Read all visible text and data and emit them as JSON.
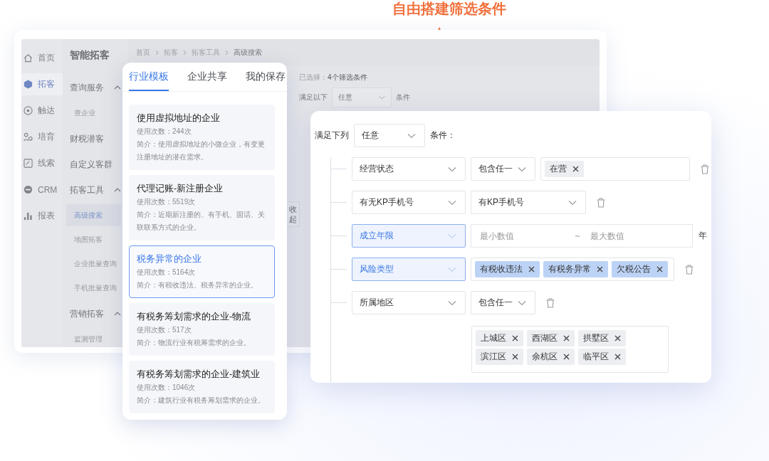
{
  "annotation": {
    "title": "自由搭建筛选条件"
  },
  "background_app": {
    "nav": [
      {
        "label": "首页",
        "selected": false
      },
      {
        "label": "拓客",
        "selected": true
      },
      {
        "label": "触达",
        "selected": false
      },
      {
        "label": "培育",
        "selected": false
      },
      {
        "label": "线索",
        "selected": false
      },
      {
        "label": "CRM",
        "selected": false
      },
      {
        "label": "报表",
        "selected": false
      }
    ],
    "sidebar": {
      "title": "智能拓客",
      "groups": [
        {
          "label": "查询服务",
          "expanded": true,
          "children": [
            {
              "label": "查企业",
              "selected": false
            }
          ]
        },
        {
          "label": "财税潜客"
        },
        {
          "label": "自定义客群"
        },
        {
          "label": "拓客工具",
          "expanded": true,
          "children": [
            {
              "label": "高级搜索",
              "selected": true
            },
            {
              "label": "地图拓客",
              "selected": false
            },
            {
              "label": "企业批量查询",
              "selected": false
            },
            {
              "label": "手机批量查询",
              "selected": false
            }
          ]
        },
        {
          "label": "营销拓客",
          "expanded": true,
          "children": [
            {
              "label": "监测管理",
              "selected": false
            }
          ]
        }
      ]
    },
    "breadcrumb": [
      "首页",
      "拓客",
      "拓客工具",
      "高级搜索"
    ],
    "selected_summary": {
      "label": "已选择：",
      "value": "4个筛选条件"
    },
    "match": {
      "prefix": "满足以下",
      "value": "任意",
      "suffix": "条件"
    },
    "collapse_button": "收起"
  },
  "template_panel": {
    "tabs": [
      {
        "label": "行业模板",
        "selected": true
      },
      {
        "label": "企业共享",
        "selected": false
      },
      {
        "label": "我的保存",
        "selected": false
      }
    ],
    "cards": [
      {
        "title": "使用虚拟地址的企业",
        "usage": "使用次数：244次",
        "intro": "简介：使用虚拟地址的小微企业，有变更注册地址的潜在需求。",
        "selected": false
      },
      {
        "title": "代理记账-新注册企业",
        "usage": "使用次数：5519次",
        "intro": "简介：近期新注册的、有手机、固话、关联联系方式的企业。",
        "selected": false
      },
      {
        "title": "税务异常的企业",
        "usage": "使用次数：5164次",
        "intro": "简介：有税收违法、税务异常的企业。",
        "selected": true
      },
      {
        "title": "有税务筹划需求的企业-物流",
        "usage": "使用次数：517次",
        "intro": "简介：物流行业有税筹需求的企业。",
        "selected": false
      },
      {
        "title": "有税务筹划需求的企业-建筑业",
        "usage": "使用次数：1046次",
        "intro": "简介：建筑行业有税务筹划需求的企业。",
        "selected": false
      }
    ]
  },
  "filter_panel": {
    "match": {
      "prefix": "满足下列",
      "value": "任意",
      "suffix": "条件："
    },
    "rules": [
      {
        "kind": "tags",
        "field": "经营状态",
        "active": false,
        "operator": "包含任一",
        "tags": [
          "在营"
        ],
        "deletable": true
      },
      {
        "kind": "choice",
        "field": "有无KP手机号",
        "active": false,
        "value": "有KP手机号",
        "deletable": true
      },
      {
        "kind": "range",
        "field": "成立年限",
        "active": true,
        "min_placeholder": "最小数值",
        "separator": "~",
        "max_placeholder": "最大数值",
        "unit": "年",
        "deletable": false
      },
      {
        "kind": "tags",
        "field": "风险类型",
        "active": true,
        "tags": [
          "有税收违法",
          "有税务异常",
          "欠税公告"
        ],
        "deletable": true
      },
      {
        "kind": "tags_below",
        "field": "所属地区",
        "active": false,
        "operator": "包含任一",
        "tags": [
          "上城区",
          "西湖区",
          "拱墅区",
          "滨江区",
          "余杭区",
          "临平区"
        ],
        "deletable": true
      }
    ]
  }
}
